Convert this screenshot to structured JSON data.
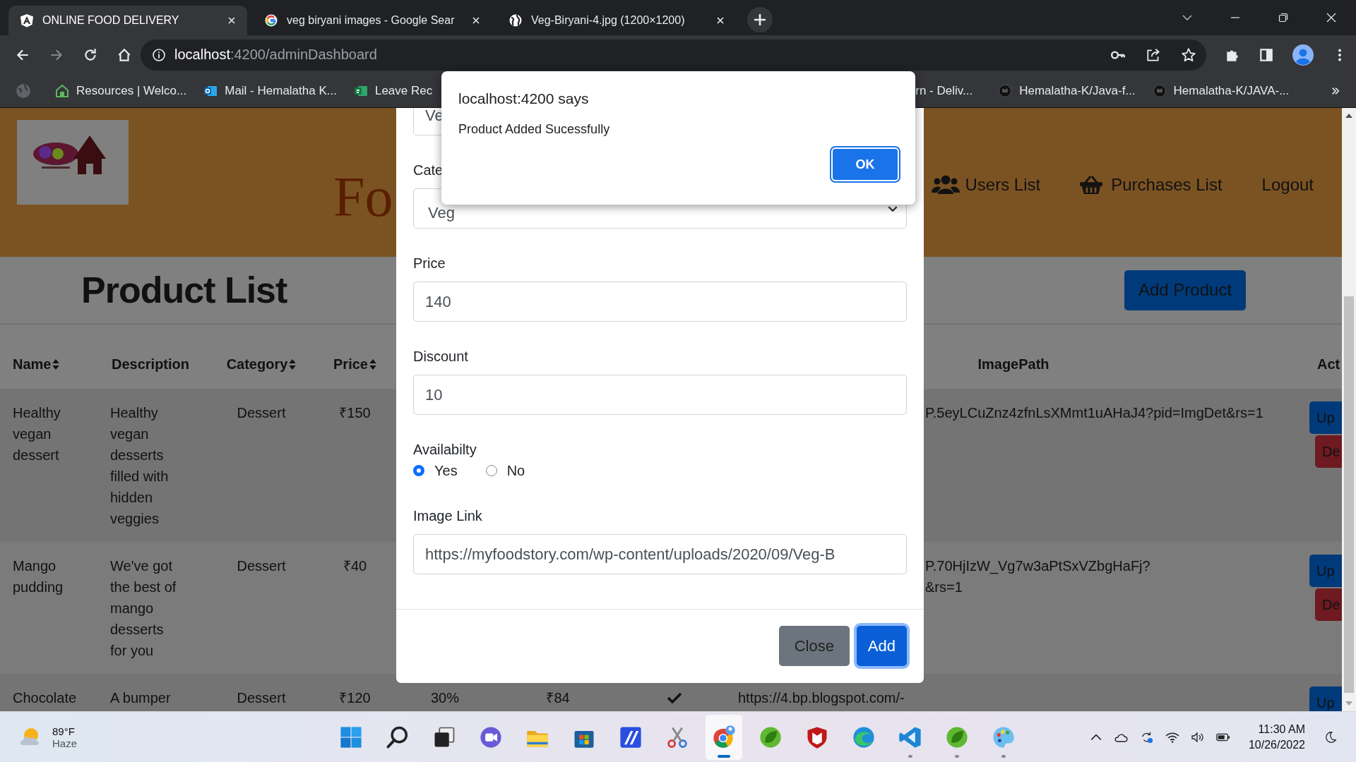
{
  "browser": {
    "tabs": [
      {
        "title": "ONLINE FOOD DELIVERY",
        "selected": true
      },
      {
        "title": "veg biryani images - Google Sear",
        "selected": false
      },
      {
        "title": "Veg-Biryani-4.jpg (1200×1200)",
        "selected": false
      }
    ],
    "address": {
      "host": "localhost",
      "path": ":4200/adminDashboard"
    },
    "bookmarks": [
      {
        "label": "Resources | Welco..."
      },
      {
        "label": "Mail - Hemalatha K..."
      },
      {
        "label": "Leave Rec"
      },
      {
        "label": "rn - Deliv..."
      },
      {
        "label": "Hemalatha-K/Java-f..."
      },
      {
        "label": "Hemalatha-K/JAVA-..."
      }
    ]
  },
  "header": {
    "title": "Fo",
    "nav": [
      {
        "label": "Users List"
      },
      {
        "label": "Purchases List"
      },
      {
        "label": "Logout"
      }
    ]
  },
  "page": {
    "title": "Product List",
    "add_button": "Add Product"
  },
  "table": {
    "columns": [
      {
        "label": "Name",
        "sortable": true
      },
      {
        "label": "Description",
        "sortable": false
      },
      {
        "label": "Category",
        "sortable": true
      },
      {
        "label": "Price",
        "sortable": true
      },
      {
        "label": "ImagePath",
        "sortable": false
      },
      {
        "label": "Act"
      }
    ],
    "rows": [
      {
        "name": [
          "Healthy",
          "vegan",
          "dessert"
        ],
        "description": [
          "Healthy",
          "vegan",
          "desserts",
          "filled with",
          "hidden",
          "veggies"
        ],
        "category": "Dessert",
        "price": "₹150",
        "image_path": [
          "P.5eyLCuZnz4zfnLsXMmt1uAHaJ4?pid=ImgDet&rs=1"
        ],
        "actions": [
          {
            "label": "Up",
            "kind": "update"
          },
          {
            "label": "De",
            "kind": "delete"
          }
        ]
      },
      {
        "name": [
          "Mango",
          "pudding"
        ],
        "description": [
          "We've got",
          "the best of",
          "mango",
          "desserts",
          "for you"
        ],
        "category": "Dessert",
        "price": "₹40",
        "image_path": [
          "P.70HjIzW_Vg7w3aPtSxVZbgHaFj?",
          "&rs=1"
        ],
        "actions": [
          {
            "label": "Up",
            "kind": "update"
          },
          {
            "label": "De",
            "kind": "delete"
          }
        ]
      },
      {
        "name": [
          "Chocolate"
        ],
        "description": [
          "A bumper"
        ],
        "category": "Dessert",
        "price": "₹120",
        "discount": "30%",
        "final_price": "₹84",
        "available": true,
        "image_path": [
          "https://4.bp.blogspot.com/-"
        ],
        "actions": [
          {
            "label": "Up",
            "kind": "update"
          }
        ]
      }
    ]
  },
  "modal": {
    "fields": [
      {
        "kind": "text",
        "value": "Ve"
      },
      {
        "kind": "select",
        "label": "Cate",
        "value": "Veg"
      },
      {
        "kind": "text",
        "label": "Price",
        "value": "140"
      },
      {
        "kind": "text",
        "label": "Discount",
        "value": "10"
      },
      {
        "kind": "radio",
        "label": "Availabilty",
        "options": [
          {
            "label": "Yes",
            "selected": true
          },
          {
            "label": "No",
            "selected": false
          }
        ]
      },
      {
        "kind": "text",
        "label": "Image Link",
        "value": "https://myfoodstory.com/wp-content/uploads/2020/09/Veg-B"
      }
    ],
    "buttons": [
      {
        "label": "Close",
        "kind": "secondary",
        "focused": false
      },
      {
        "label": "Add",
        "kind": "primary",
        "focused": true
      }
    ]
  },
  "alert": {
    "title": "localhost:4200 says",
    "message": "Product Added Sucessfully",
    "button": "OK"
  },
  "taskbar": {
    "weather": {
      "temperature": "89°F",
      "condition": "Haze"
    },
    "apps": [
      {
        "running": false,
        "selected": false
      },
      {
        "running": false,
        "selected": false
      },
      {
        "running": false,
        "selected": false
      },
      {
        "running": false,
        "selected": false
      },
      {
        "running": false,
        "selected": false
      },
      {
        "running": false,
        "selected": false
      },
      {
        "running": false,
        "selected": false
      },
      {
        "running": false,
        "selected": false
      },
      {
        "running": true,
        "selected": true
      },
      {
        "running": false,
        "selected": false
      },
      {
        "running": false,
        "selected": false
      },
      {
        "running": false,
        "selected": false
      },
      {
        "running": true,
        "selected": false
      },
      {
        "running": true,
        "selected": false
      },
      {
        "running": true,
        "selected": false
      }
    ],
    "time": "11:30 AM",
    "date": "10/26/2022"
  }
}
